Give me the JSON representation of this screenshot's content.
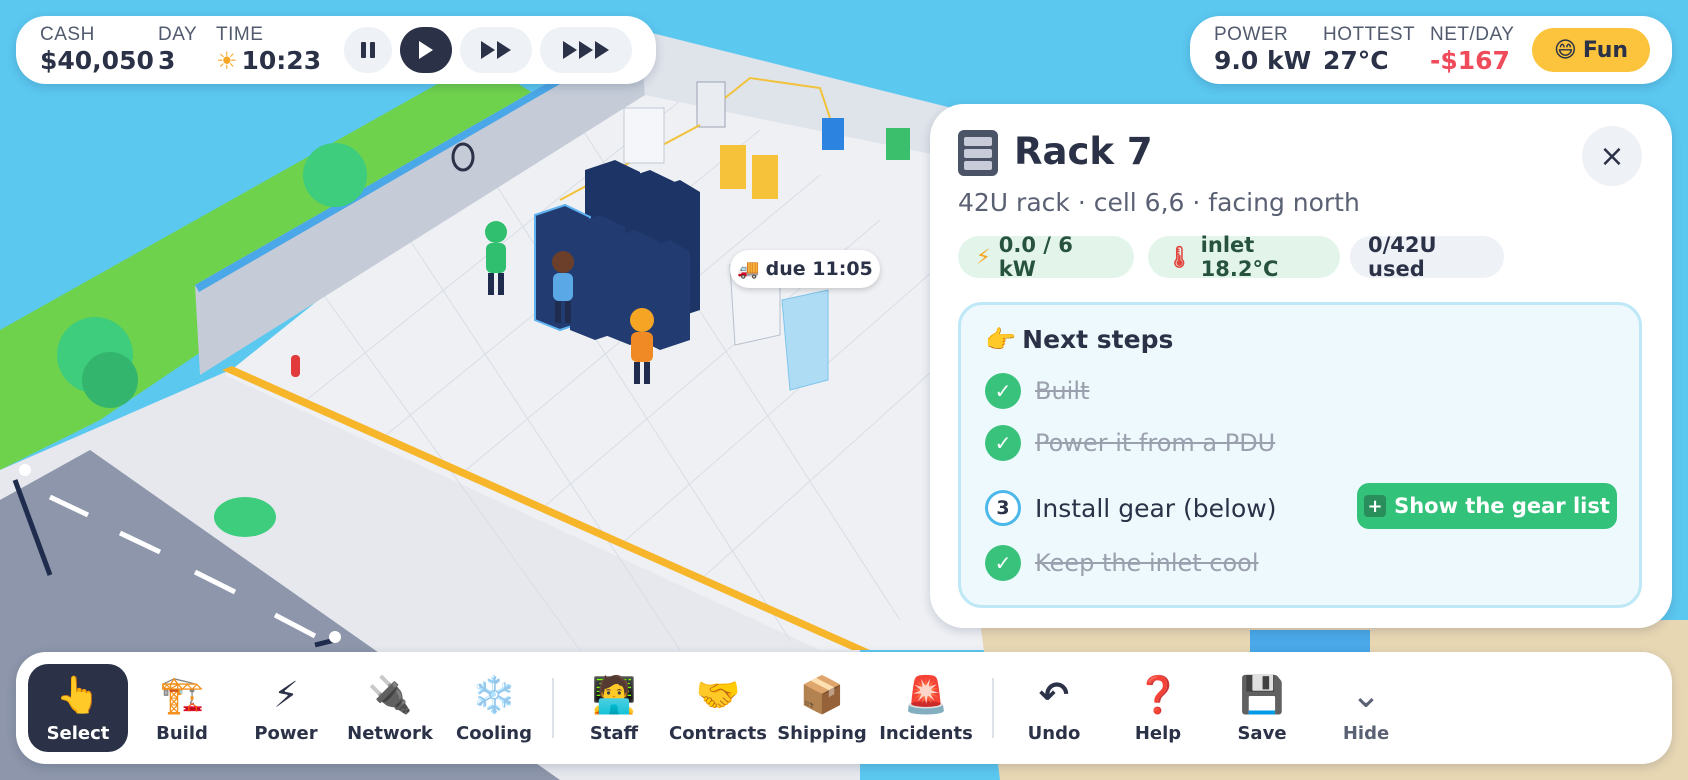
{
  "hud": {
    "cash_label": "CASH",
    "cash_value": "$40,050",
    "day_label": "DAY",
    "day_value": "3",
    "time_label": "TIME",
    "time_value": "10:23",
    "speed_buttons": [
      "pause",
      "play",
      "fast",
      "faster"
    ],
    "active_speed": "play",
    "power_label": "POWER",
    "power_value": "9.0 kW",
    "hottest_label": "HOTTEST",
    "hottest_value": "27°C",
    "netday_label": "NET/DAY",
    "netday_value": "-$167",
    "mood_label": "Fun",
    "mood_icon": "😄"
  },
  "scene": {
    "delivery_tag": "due 11:05"
  },
  "panel": {
    "title": "Rack 7",
    "subtitle": "42U rack · cell 6,6 · facing north",
    "pills": {
      "power": "0.0 / 6 kW",
      "inlet": "inlet 18.2°C",
      "usage": "0/42U used"
    },
    "next_steps_title": "Next steps",
    "steps": [
      {
        "text": "Built",
        "done": true
      },
      {
        "text": "Power it from a PDU",
        "done": true
      },
      {
        "text": "Install gear (below)",
        "done": false,
        "number": "3"
      },
      {
        "text": "Keep the inlet cool",
        "done": true
      }
    ],
    "gear_button": "Show the gear list",
    "close_icon": "×"
  },
  "toolbar": {
    "items": [
      {
        "label": "Select",
        "icon": "👆",
        "active": true
      },
      {
        "label": "Build",
        "icon": "🏗️"
      },
      {
        "label": "Power",
        "icon": "⚡"
      },
      {
        "label": "Network",
        "icon": "🔌"
      },
      {
        "label": "Cooling",
        "icon": "❄️"
      },
      {
        "label": "Staff",
        "icon": "🧑‍💻"
      },
      {
        "label": "Contracts",
        "icon": "🤝"
      },
      {
        "label": "Shipping",
        "icon": "📦"
      },
      {
        "label": "Incidents",
        "icon": "🚨"
      },
      {
        "label": "Undo",
        "icon": "↶"
      },
      {
        "label": "Help",
        "icon": "❓"
      },
      {
        "label": "Save",
        "icon": "💾"
      },
      {
        "label": "Hide",
        "icon": "⌄"
      }
    ]
  },
  "colors": {
    "sky": "#5bc8f0",
    "grass": "#6fd24c",
    "floor": "#eef0f4",
    "rack": "#1d3566",
    "accent_green": "#33c27a",
    "negative": "#ef4b5b",
    "mood": "#fcc43d",
    "dark": "#2b3247"
  }
}
